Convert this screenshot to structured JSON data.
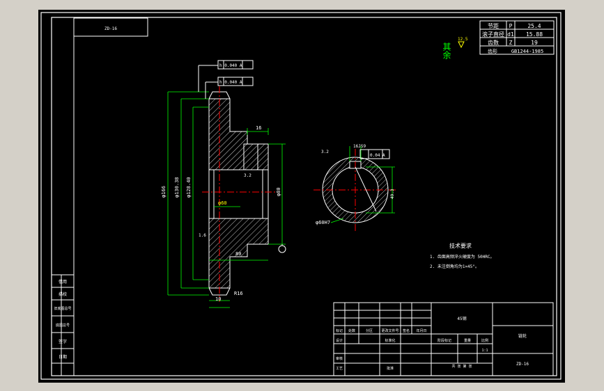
{
  "title_block": {
    "drawing_no": "ZD-16"
  },
  "param_table": {
    "rows": [
      {
        "label": "节距",
        "sym": "P",
        "value": "25.4"
      },
      {
        "label": "滚子直径",
        "sym": "d1",
        "value": "15.88"
      },
      {
        "label": "齿数",
        "sym": "Z",
        "value": "19"
      },
      {
        "label": "齿形",
        "sym": "",
        "value": "GB1244-1985"
      }
    ]
  },
  "surface": {
    "label": "其余",
    "roughness": "12.5"
  },
  "tolerances": {
    "runout1": "h 0.040 A",
    "runout2": "h 0.040 A",
    "sym": "0.04 A"
  },
  "dims": {
    "d_tip": "φ166",
    "d_root": "φ128.40",
    "d_mid": "φ130.38",
    "hub_dia": "φ80",
    "hub_len": "80",
    "boss_w": "16",
    "tooth_w": "10",
    "r_chamfer": "R16",
    "bore": "φ60",
    "bore_fit": "φ60H7",
    "keyway": "16JS9",
    "key_depth": "49.3",
    "s1": "3.2",
    "s2": "1.6",
    "s3": "3.2"
  },
  "notes": {
    "title": "技术要求",
    "items": [
      "1. 齿面高频淬火硬度为 50HRC。",
      "2. 未注倒角均为1×45°。"
    ]
  },
  "side_labels": [
    "借用",
    "描校",
    "旧底图总号",
    "底图总号",
    "签字",
    "日期"
  ],
  "title_table": {
    "material": "45钢",
    "name": "链轮",
    "code": "ZD-16",
    "header_cells": [
      "标记",
      "处数",
      "分区",
      "更改文件号",
      "签名",
      "年月日"
    ],
    "design": "设计",
    "std": "标准化",
    "check": "审核",
    "proc": "工艺",
    "approve": "批准",
    "stage": "阶段标记",
    "weight": "重量",
    "scale": "比例",
    "scale_val": "1:1",
    "sheet": "共 张 第 张"
  }
}
